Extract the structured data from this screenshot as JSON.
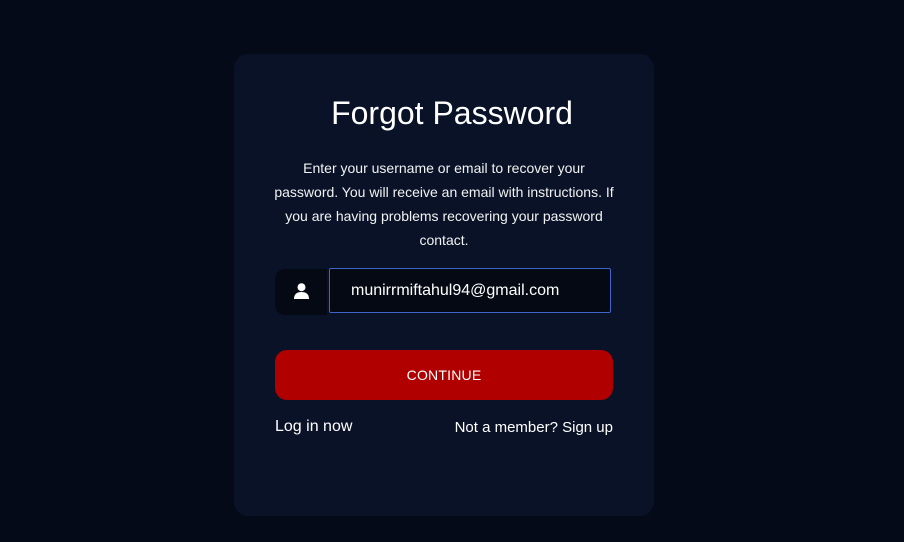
{
  "card": {
    "title": "Forgot Password",
    "description": "Enter your username or email to recover your password. You will receive an email with instructions. If you are having problems recovering your password contact."
  },
  "form": {
    "user_icon": "user-icon",
    "email_value": "munirrmiftahul94@gmail.com",
    "continue_label": "CONTINUE"
  },
  "links": {
    "login": "Log in now",
    "signup": "Not a member? Sign up"
  },
  "colors": {
    "background": "#050a18",
    "card": "#0a1228",
    "button": "#b00000",
    "input_border": "#3d66c8"
  }
}
